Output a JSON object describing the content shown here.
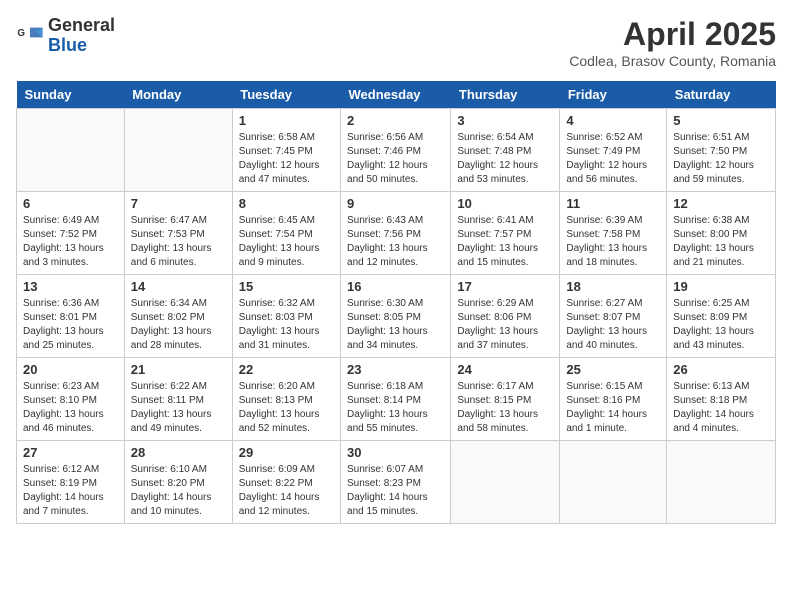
{
  "logo": {
    "general": "General",
    "blue": "Blue"
  },
  "title": "April 2025",
  "location": "Codlea, Brasov County, Romania",
  "headers": [
    "Sunday",
    "Monday",
    "Tuesday",
    "Wednesday",
    "Thursday",
    "Friday",
    "Saturday"
  ],
  "weeks": [
    [
      {
        "num": "",
        "info": ""
      },
      {
        "num": "",
        "info": ""
      },
      {
        "num": "1",
        "info": "Sunrise: 6:58 AM\nSunset: 7:45 PM\nDaylight: 12 hours and 47 minutes."
      },
      {
        "num": "2",
        "info": "Sunrise: 6:56 AM\nSunset: 7:46 PM\nDaylight: 12 hours and 50 minutes."
      },
      {
        "num": "3",
        "info": "Sunrise: 6:54 AM\nSunset: 7:48 PM\nDaylight: 12 hours and 53 minutes."
      },
      {
        "num": "4",
        "info": "Sunrise: 6:52 AM\nSunset: 7:49 PM\nDaylight: 12 hours and 56 minutes."
      },
      {
        "num": "5",
        "info": "Sunrise: 6:51 AM\nSunset: 7:50 PM\nDaylight: 12 hours and 59 minutes."
      }
    ],
    [
      {
        "num": "6",
        "info": "Sunrise: 6:49 AM\nSunset: 7:52 PM\nDaylight: 13 hours and 3 minutes."
      },
      {
        "num": "7",
        "info": "Sunrise: 6:47 AM\nSunset: 7:53 PM\nDaylight: 13 hours and 6 minutes."
      },
      {
        "num": "8",
        "info": "Sunrise: 6:45 AM\nSunset: 7:54 PM\nDaylight: 13 hours and 9 minutes."
      },
      {
        "num": "9",
        "info": "Sunrise: 6:43 AM\nSunset: 7:56 PM\nDaylight: 13 hours and 12 minutes."
      },
      {
        "num": "10",
        "info": "Sunrise: 6:41 AM\nSunset: 7:57 PM\nDaylight: 13 hours and 15 minutes."
      },
      {
        "num": "11",
        "info": "Sunrise: 6:39 AM\nSunset: 7:58 PM\nDaylight: 13 hours and 18 minutes."
      },
      {
        "num": "12",
        "info": "Sunrise: 6:38 AM\nSunset: 8:00 PM\nDaylight: 13 hours and 21 minutes."
      }
    ],
    [
      {
        "num": "13",
        "info": "Sunrise: 6:36 AM\nSunset: 8:01 PM\nDaylight: 13 hours and 25 minutes."
      },
      {
        "num": "14",
        "info": "Sunrise: 6:34 AM\nSunset: 8:02 PM\nDaylight: 13 hours and 28 minutes."
      },
      {
        "num": "15",
        "info": "Sunrise: 6:32 AM\nSunset: 8:03 PM\nDaylight: 13 hours and 31 minutes."
      },
      {
        "num": "16",
        "info": "Sunrise: 6:30 AM\nSunset: 8:05 PM\nDaylight: 13 hours and 34 minutes."
      },
      {
        "num": "17",
        "info": "Sunrise: 6:29 AM\nSunset: 8:06 PM\nDaylight: 13 hours and 37 minutes."
      },
      {
        "num": "18",
        "info": "Sunrise: 6:27 AM\nSunset: 8:07 PM\nDaylight: 13 hours and 40 minutes."
      },
      {
        "num": "19",
        "info": "Sunrise: 6:25 AM\nSunset: 8:09 PM\nDaylight: 13 hours and 43 minutes."
      }
    ],
    [
      {
        "num": "20",
        "info": "Sunrise: 6:23 AM\nSunset: 8:10 PM\nDaylight: 13 hours and 46 minutes."
      },
      {
        "num": "21",
        "info": "Sunrise: 6:22 AM\nSunset: 8:11 PM\nDaylight: 13 hours and 49 minutes."
      },
      {
        "num": "22",
        "info": "Sunrise: 6:20 AM\nSunset: 8:13 PM\nDaylight: 13 hours and 52 minutes."
      },
      {
        "num": "23",
        "info": "Sunrise: 6:18 AM\nSunset: 8:14 PM\nDaylight: 13 hours and 55 minutes."
      },
      {
        "num": "24",
        "info": "Sunrise: 6:17 AM\nSunset: 8:15 PM\nDaylight: 13 hours and 58 minutes."
      },
      {
        "num": "25",
        "info": "Sunrise: 6:15 AM\nSunset: 8:16 PM\nDaylight: 14 hours and 1 minute."
      },
      {
        "num": "26",
        "info": "Sunrise: 6:13 AM\nSunset: 8:18 PM\nDaylight: 14 hours and 4 minutes."
      }
    ],
    [
      {
        "num": "27",
        "info": "Sunrise: 6:12 AM\nSunset: 8:19 PM\nDaylight: 14 hours and 7 minutes."
      },
      {
        "num": "28",
        "info": "Sunrise: 6:10 AM\nSunset: 8:20 PM\nDaylight: 14 hours and 10 minutes."
      },
      {
        "num": "29",
        "info": "Sunrise: 6:09 AM\nSunset: 8:22 PM\nDaylight: 14 hours and 12 minutes."
      },
      {
        "num": "30",
        "info": "Sunrise: 6:07 AM\nSunset: 8:23 PM\nDaylight: 14 hours and 15 minutes."
      },
      {
        "num": "",
        "info": ""
      },
      {
        "num": "",
        "info": ""
      },
      {
        "num": "",
        "info": ""
      }
    ]
  ]
}
